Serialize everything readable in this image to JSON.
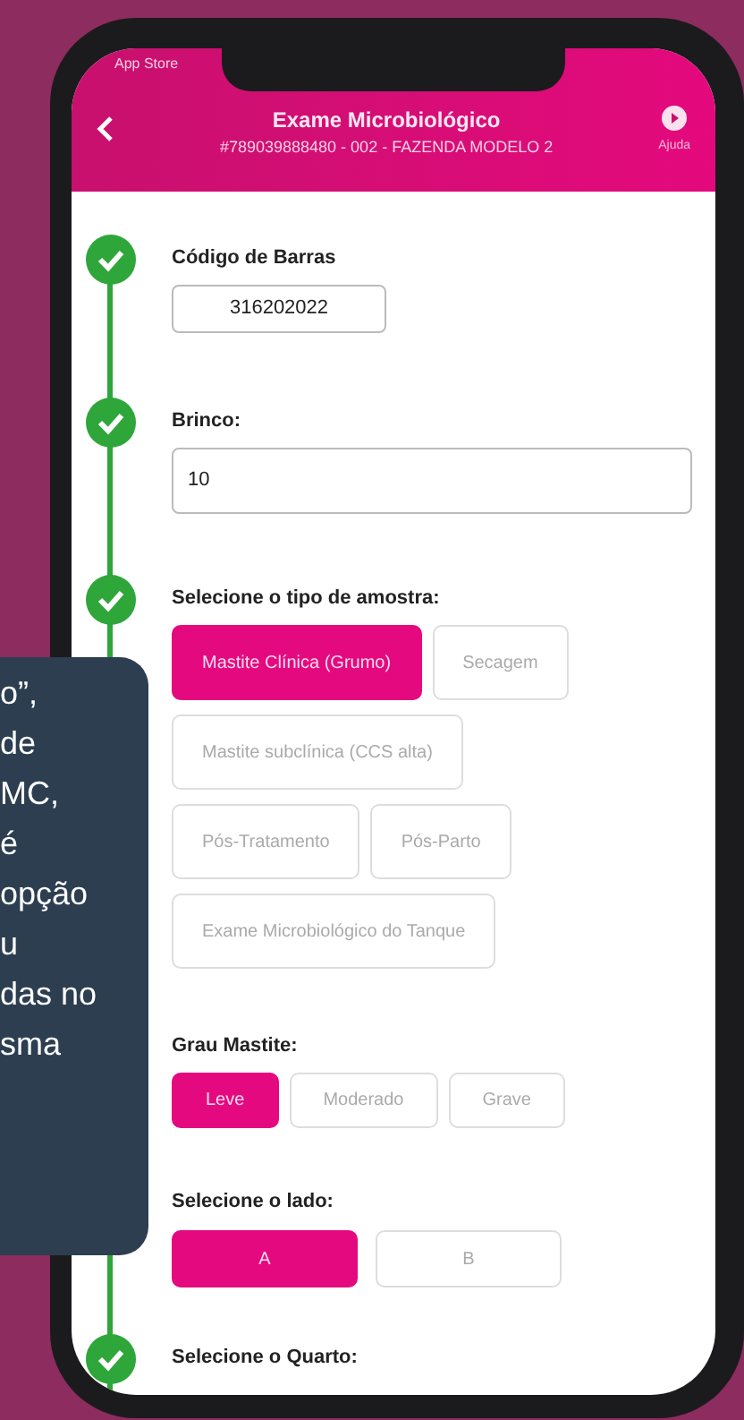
{
  "status_bar": {
    "carrier": "App Store"
  },
  "header": {
    "title": "Exame Microbiológico",
    "subtitle": "#789039888480 - 002 - FAZENDA MODELO 2",
    "help": "Ajuda"
  },
  "sections": [
    {
      "kind": "short_field",
      "label": "Código de Barras",
      "value": "316202022",
      "step": {
        "completed": true
      }
    },
    {
      "kind": "text_field",
      "label": "Brinco:",
      "value": "10",
      "step": {
        "completed": true
      }
    },
    {
      "kind": "chips",
      "label": "Selecione o tipo de amostra:",
      "step": {
        "completed": true
      },
      "option_rows": [
        [
          {
            "label": "Mastite Clínica (Grumo)",
            "selected": true
          },
          {
            "label": "Secagem",
            "selected": false
          }
        ],
        [
          {
            "label": "Mastite subclínica (CCS alta)",
            "selected": false
          }
        ],
        [
          {
            "label": "Pós-Tratamento",
            "selected": false
          },
          {
            "label": "Pós-Parto",
            "selected": false
          }
        ],
        [
          {
            "label": "Exame Microbiológico do Tanque",
            "selected": false
          }
        ]
      ]
    },
    {
      "kind": "small_chips",
      "label": "Grau Mastite:",
      "option_rows": [
        [
          {
            "label": "Leve",
            "selected": true
          },
          {
            "label": "Moderado",
            "selected": false
          },
          {
            "label": "Grave",
            "selected": false
          }
        ]
      ]
    },
    {
      "kind": "segmented",
      "label": "Selecione o lado:",
      "option_rows": [
        [
          {
            "label": "A",
            "selected": true
          },
          {
            "label": "B",
            "selected": false
          }
        ]
      ]
    },
    {
      "kind": "heading",
      "label": "Selecione o Quarto:",
      "step": {
        "completed": true
      }
    }
  ],
  "tooltip": {
    "lines": [
      "o”,",
      "de",
      "MC,",
      "é",
      "opção",
      "u",
      "das no",
      "sma"
    ]
  }
}
